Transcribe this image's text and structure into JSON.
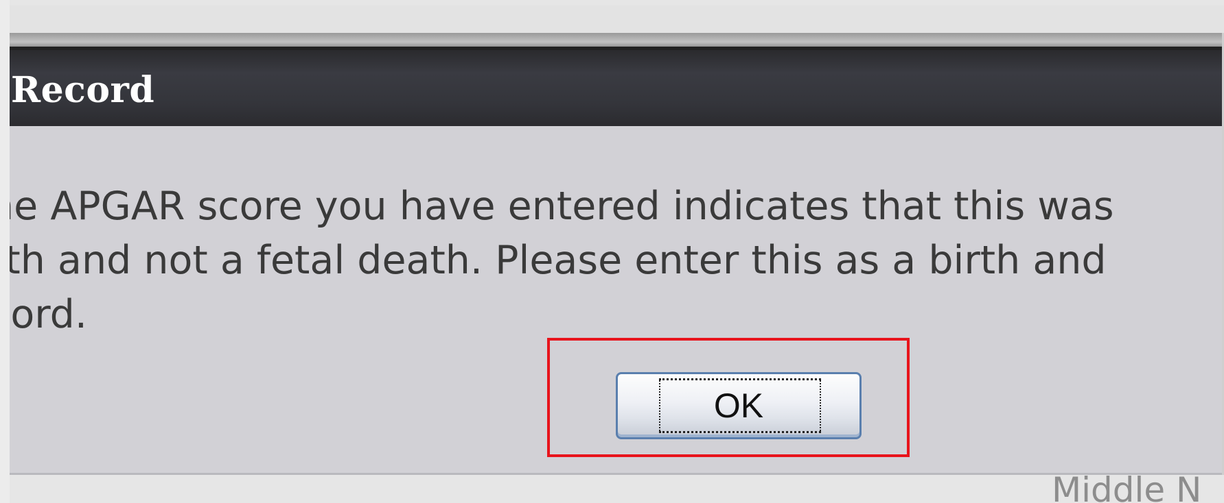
{
  "dialog": {
    "title": "w Record",
    "message_lines": [
      "he APGAR score you have entered indicates that this was",
      "rth and not a fetal death. Please enter this as a birth and",
      "cord."
    ],
    "ok_label": "OK"
  },
  "background": {
    "field_label": "Middle N"
  },
  "colors": {
    "title_bar": "#34353b",
    "dialog_body": "#d2d1d6",
    "highlight": "#e8141c",
    "button_border": "#5a7fae"
  }
}
